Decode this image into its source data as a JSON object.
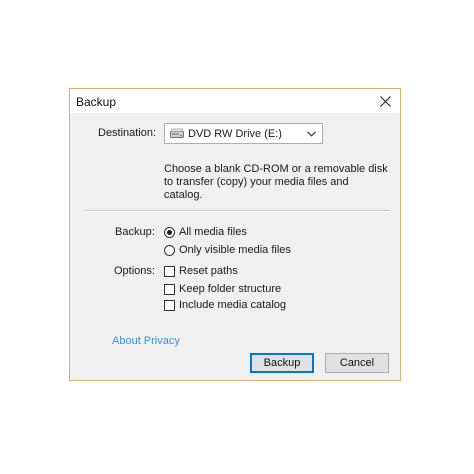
{
  "window": {
    "title": "Backup",
    "close_icon": "close-icon"
  },
  "destination": {
    "label": "Destination:",
    "selected": "DVD RW Drive (E:)",
    "icon": "dvd-drive-icon",
    "description": "Choose a blank CD-ROM or a removable disk to transfer (copy) your media files and catalog."
  },
  "backup": {
    "label": "Backup:",
    "options": [
      {
        "label": "All media files",
        "checked": true
      },
      {
        "label": "Only visible media files",
        "checked": false
      }
    ]
  },
  "options": {
    "label": "Options:",
    "items": [
      {
        "label": "Reset paths",
        "checked": false
      },
      {
        "label": "Keep folder structure",
        "checked": false
      },
      {
        "label": "Include media catalog",
        "checked": false
      }
    ]
  },
  "links": {
    "privacy": "About Privacy"
  },
  "buttons": {
    "backup": "Backup",
    "cancel": "Cancel"
  },
  "colors": {
    "border_accent": "#d8b46e",
    "link": "#3b8fd4",
    "default_button_border": "#0078d7"
  }
}
